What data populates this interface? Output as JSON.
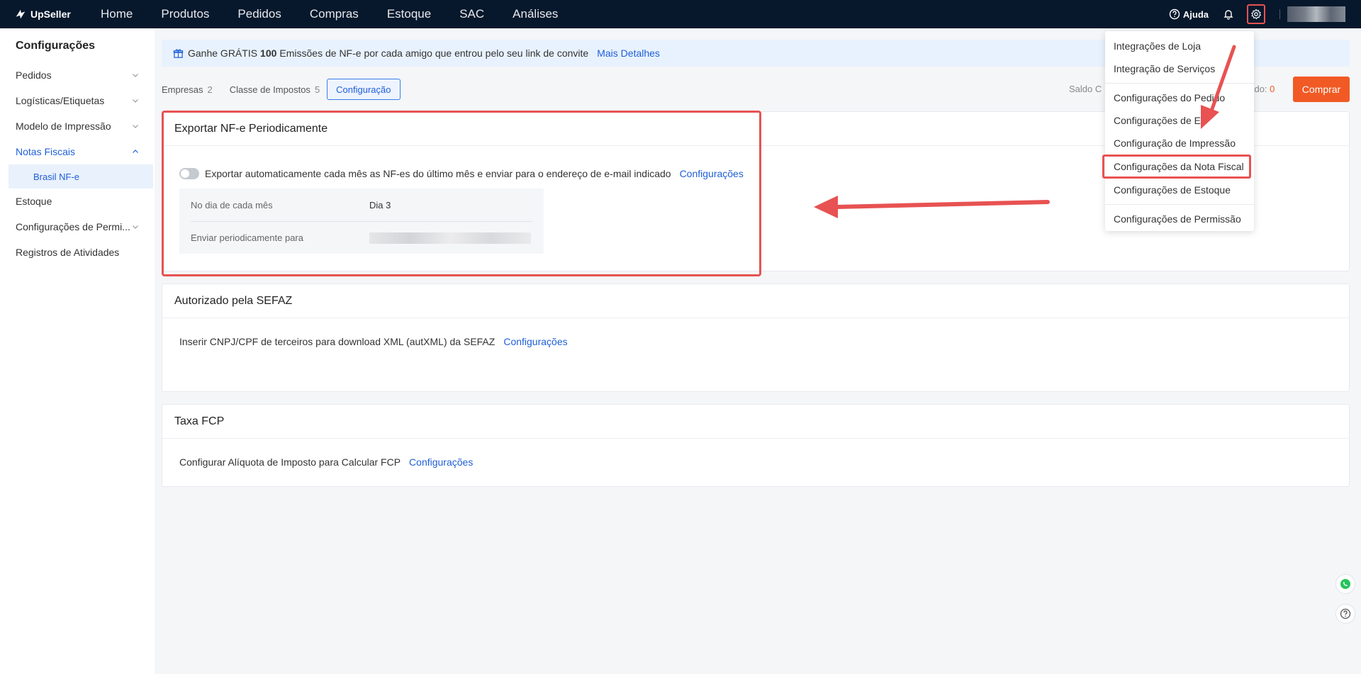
{
  "topbar": {
    "logo": "UpSeller",
    "nav": [
      "Home",
      "Produtos",
      "Pedidos",
      "Compras",
      "Estoque",
      "SAC",
      "Análises"
    ],
    "help_label": "Ajuda"
  },
  "sidebar": {
    "title": "Configurações",
    "items": [
      {
        "label": "Pedidos"
      },
      {
        "label": "Logísticas/Etiquetas"
      },
      {
        "label": "Modelo de Impressão"
      },
      {
        "label": "Notas Fiscais"
      },
      {
        "label": "Brasil NF-e"
      },
      {
        "label": "Estoque"
      },
      {
        "label": "Configurações de Permi..."
      },
      {
        "label": "Registros de Atividades"
      }
    ]
  },
  "banner": {
    "prefix": "Ganhe GRÁTIS",
    "count": "100",
    "suffix": "Emissões de NF-e por cada amigo que entrou pelo seu link de convite",
    "link": "Mais Detalhes"
  },
  "tabs": [
    {
      "label": "Empresas",
      "count": "2"
    },
    {
      "label": "Classe de Impostos",
      "count": "5"
    },
    {
      "label": "Configuração",
      "count": ""
    }
  ],
  "balance": {
    "label_start": "Saldo C",
    "label_end": "eado:",
    "value": "0",
    "buy": "Comprar"
  },
  "export_card": {
    "title": "Exportar NF-e Periodicamente",
    "toggle_text": "Exportar automaticamente cada mês as NF-es do último mês e enviar para o endereço de e-mail indicado",
    "link": "Configurações",
    "day_label": "No dia de cada mês",
    "day_value": "Dia 3",
    "send_label": "Enviar periodicamente para"
  },
  "sefaz_card": {
    "title": "Autorizado pela SEFAZ",
    "text": "Inserir CNPJ/CPF de terceiros para download XML (autXML) da SEFAZ",
    "link": "Configurações"
  },
  "fcp_card": {
    "title": "Taxa FCP",
    "text": "Configurar Alíquota de Imposto para Calcular FCP",
    "link": "Configurações"
  },
  "dropdown": {
    "items": [
      "Integrações de Loja",
      "Integração de Serviços",
      "Configurações do Pedido",
      "Configurações de E",
      "Configuração de Impressão",
      "Configurações da Nota Fiscal",
      "Configurações de Estoque",
      "Configurações de Permissão"
    ]
  },
  "colors": {
    "topbar": "#07182c",
    "accent": "#1f5fd6",
    "highlight": "#e85252",
    "buy": "#f15a24"
  }
}
